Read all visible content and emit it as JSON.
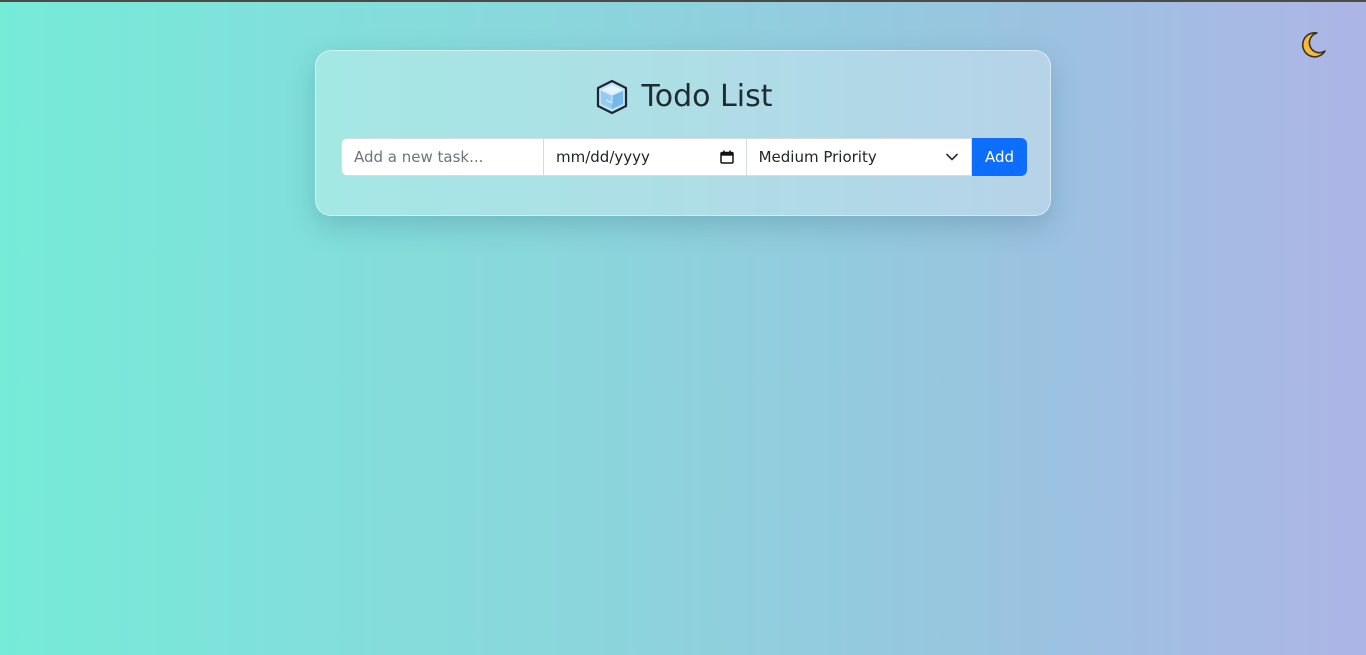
{
  "header": {
    "title": "Todo List",
    "title_icon": "cube-icon",
    "theme_toggle_icon": "crescent-moon-icon"
  },
  "form": {
    "task_placeholder": "Add a new task...",
    "task_value": "",
    "date_placeholder": "mm/dd/yyyy",
    "priority_selected": "Medium Priority",
    "add_label": "Add"
  },
  "colors": {
    "accent": "#0d6efd",
    "moon": "#f6b93b"
  }
}
